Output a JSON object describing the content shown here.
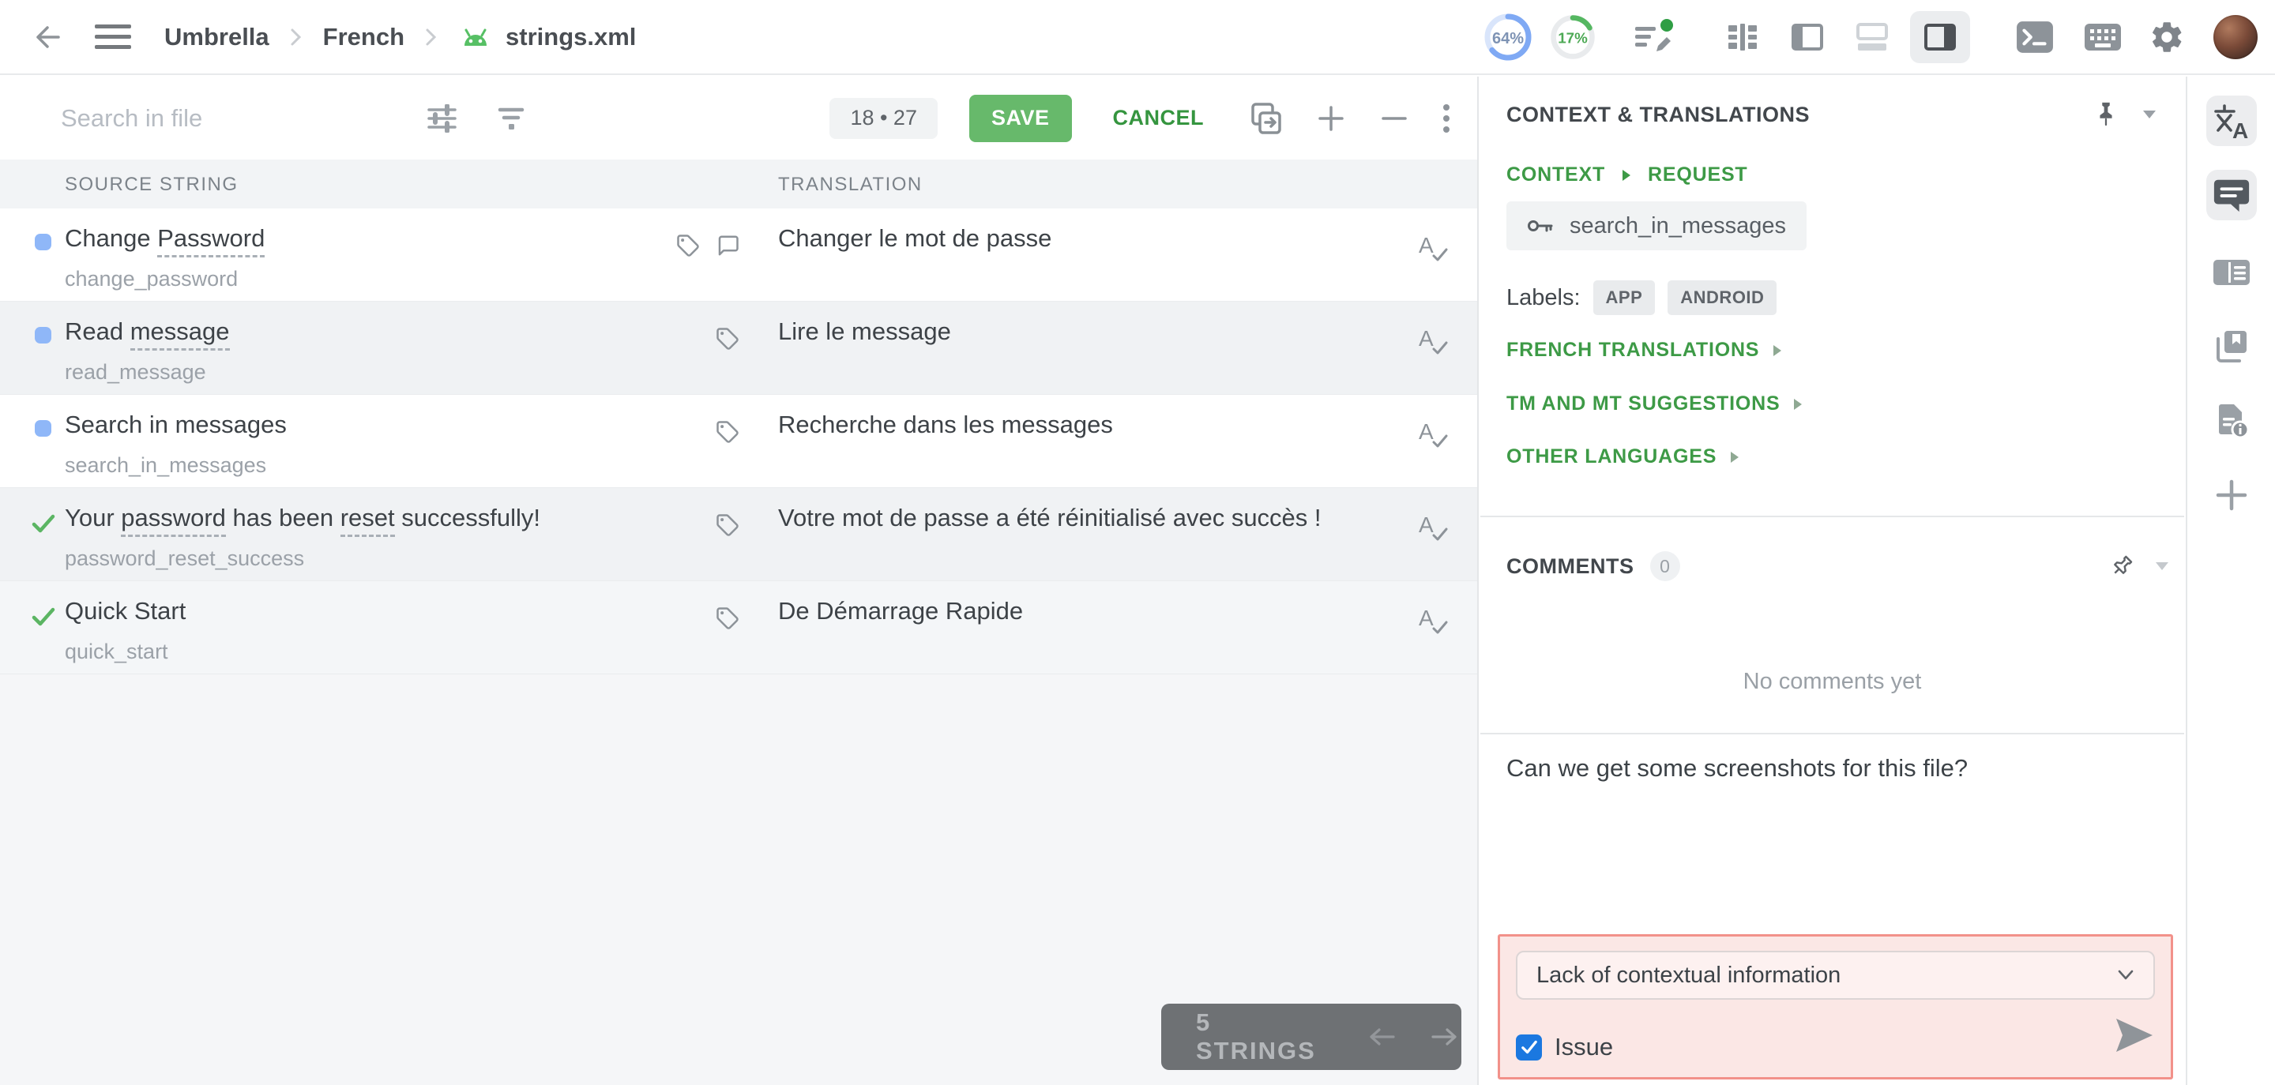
{
  "topbar": {
    "breadcrumb": [
      "Umbrella",
      "French",
      "strings.xml"
    ],
    "progress_translated": "64%",
    "progress_approved": "17%",
    "icons": [
      "back-icon",
      "menu-icon",
      "android-file-icon",
      "translated-progress-ring",
      "approved-progress-ring",
      "tasks-edit-icon",
      "comfortable-view-icon",
      "side-by-side-view-icon",
      "bottom-panel-view-icon",
      "right-panel-view-icon",
      "terminal-icon",
      "keyboard-shortcuts-icon",
      "gear-icon",
      "avatar"
    ]
  },
  "toolbar": {
    "search_placeholder": "Search in file",
    "counter": "18 • 27",
    "save_label": "SAVE",
    "cancel_label": "CANCEL",
    "icons": [
      "advanced-filter-icon",
      "filter-icon",
      "copy-source-icon",
      "zoom-in-icon",
      "zoom-out-icon",
      "more-menu-icon"
    ]
  },
  "table": {
    "headers": [
      "SOURCE STRING",
      "TRANSLATION"
    ],
    "rows": [
      {
        "status": "translated",
        "source_parts": [
          {
            "t": "Change "
          },
          {
            "t": "Password",
            "term": true
          }
        ],
        "key": "change_password",
        "translation": "Changer le mot de passe",
        "has_comment": true
      },
      {
        "status": "translated",
        "source_parts": [
          {
            "t": "Read "
          },
          {
            "t": "message",
            "term": true
          }
        ],
        "key": "read_message",
        "translation": "Lire le message"
      },
      {
        "status": "translated",
        "source_parts": [
          {
            "t": "Search in messages"
          }
        ],
        "key": "search_in_messages",
        "translation": "Recherche dans les messages"
      },
      {
        "status": "approved",
        "source_parts": [
          {
            "t": "Your "
          },
          {
            "t": "password",
            "term": true
          },
          {
            "t": " has been "
          },
          {
            "t": "reset",
            "term": true
          },
          {
            "t": " successfully!"
          }
        ],
        "key": "password_reset_success",
        "translation": "Votre mot de passe a été réinitialisé avec succès !"
      },
      {
        "status": "approved",
        "source_parts": [
          {
            "t": "Quick Start"
          }
        ],
        "key": "quick_start",
        "translation": "De Démarrage Rapide"
      }
    ]
  },
  "footer": {
    "strings_label": "5 STRINGS",
    "icons": [
      "previous-page-arrow-icon",
      "next-page-arrow-icon"
    ]
  },
  "panel": {
    "title": "CONTEXT & TRANSLATIONS",
    "context_link": "CONTEXT",
    "request_link": "REQUEST",
    "string_key": "search_in_messages",
    "labels_caption": "Labels:",
    "labels": [
      "APP",
      "ANDROID"
    ],
    "sections": [
      "FRENCH TRANSLATIONS",
      "TM AND MT SUGGESTIONS",
      "OTHER LANGUAGES"
    ],
    "comments": {
      "title": "COMMENTS",
      "count": "0",
      "empty_text": "No comments yet",
      "draft_text": "Can we get some screenshots for this file?",
      "issue_type_selected": "Lack of contextual information",
      "issue_checkbox_label": "Issue",
      "issue_checked": true
    },
    "icons": [
      "pin-icon",
      "chevron-down-icon",
      "key-icon",
      "unpin-icon",
      "send-icon",
      "issue-checkbox"
    ]
  },
  "rail": {
    "icons": [
      "translate-icon",
      "comments-panel-icon",
      "context-card-icon",
      "glossary-pages-icon",
      "file-info-icon",
      "add-panel-icon"
    ]
  },
  "colors": {
    "accent_green": "#3d9a46",
    "save_green": "#67b96b",
    "status_blue": "#8fb7f8",
    "check_green": "#5bb563",
    "progress_blue": "#7fa9f4",
    "progress_green": "#55b761",
    "issue_border_red": "#f2918a",
    "issue_bg_pink": "#fbe7e5",
    "checkbox_blue": "#1b78e0",
    "android_green": "#57c065",
    "dark_button_gray": "#6e7174"
  }
}
